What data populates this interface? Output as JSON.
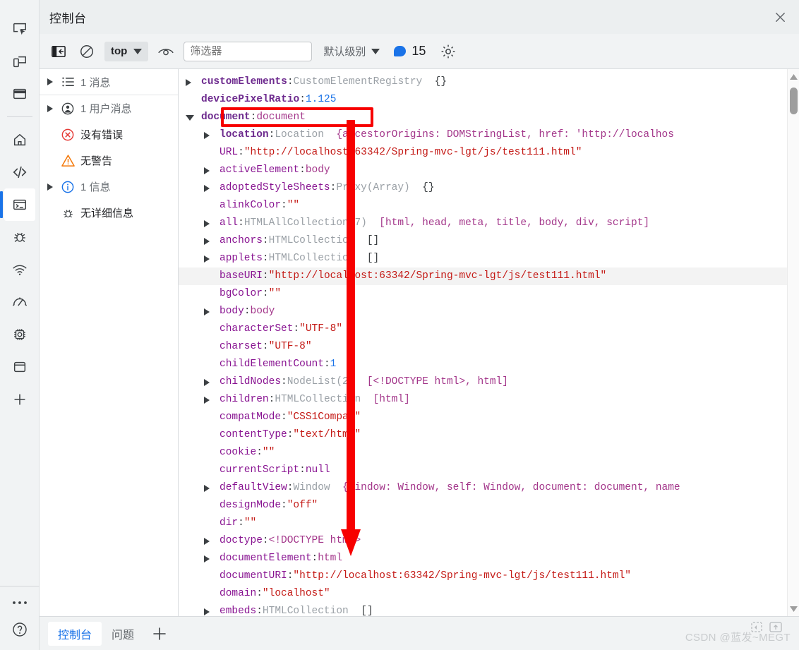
{
  "rail": {
    "icons": [
      {
        "name": "inspect-element-icon",
        "label": "检查元素"
      },
      {
        "name": "device-toolbar-icon",
        "label": "设备工具栏"
      },
      {
        "name": "elements-panel-icon",
        "label": "元素面板"
      },
      {
        "name": "home-icon",
        "label": "主页"
      },
      {
        "name": "sources-code-icon",
        "label": "源代码"
      },
      {
        "name": "console-terminal-icon",
        "label": "控制台"
      },
      {
        "name": "bug-icon",
        "label": "调试"
      },
      {
        "name": "network-wifi-icon",
        "label": "网络"
      },
      {
        "name": "performance-gauge-icon",
        "label": "性能"
      },
      {
        "name": "memory-chip-icon",
        "label": "内存"
      },
      {
        "name": "application-storage-icon",
        "label": "应用"
      },
      {
        "name": "add-panel-icon",
        "label": "添加"
      }
    ],
    "bottom": [
      {
        "name": "more-options-icon",
        "label": "更多选项"
      },
      {
        "name": "help-icon",
        "label": "帮助"
      }
    ]
  },
  "titlebar": {
    "title": "控制台",
    "close_label": "关闭"
  },
  "toolbar": {
    "clear_console_label": "清除控制台",
    "no_entry_label": "停止",
    "context": {
      "value": "top",
      "caret": "chevron-down-icon"
    },
    "eye_label": "实时表达式",
    "filter": {
      "value": "",
      "placeholder": "筛选器"
    },
    "level": {
      "value": "默认级别",
      "caret": "chevron-down-icon"
    },
    "message_count": "15",
    "settings_label": "设置"
  },
  "sidebar": {
    "items": [
      {
        "icon": "list-icon",
        "count": "1",
        "label": "消息",
        "expandable": true,
        "bordered": true
      },
      {
        "icon": "user-icon",
        "count": "1",
        "label": "用户消息",
        "expandable": true,
        "bordered": false
      },
      {
        "icon": "error-icon",
        "count": "",
        "label": "没有错误",
        "expandable": false,
        "bordered": false
      },
      {
        "icon": "warning-icon",
        "count": "",
        "label": "无警告",
        "expandable": false,
        "bordered": false
      },
      {
        "icon": "info-icon",
        "count": "1",
        "label": "信息",
        "expandable": true,
        "bordered": false
      },
      {
        "icon": "verbose-bug-icon",
        "count": "",
        "label": "无详细信息",
        "expandable": false,
        "bordered": false
      }
    ]
  },
  "console": {
    "lines": [
      {
        "arrow": "right",
        "indent": 1,
        "key": "customElements",
        "bold": true,
        "sep": ":",
        "type": "CustomElementRegistry",
        "preview": "{}",
        "previewKind": "punct",
        "highlight": false
      },
      {
        "arrow": "none",
        "indent": 1,
        "key": "devicePixelRatio",
        "bold": true,
        "sep": ":",
        "value": "1.125",
        "valueKind": "num",
        "highlight": false
      },
      {
        "arrow": "down",
        "indent": 1,
        "key": "document",
        "bold": true,
        "sep": ":",
        "value": "document",
        "valueKind": "prev",
        "highlight": false
      },
      {
        "arrow": "right",
        "indent": 2,
        "key": "location",
        "bold": true,
        "sep": ":",
        "type": "Location",
        "preview": "{ancestorOrigins: DOMStringList, href: 'http://localhos",
        "previewKind": "prev",
        "highlight": false
      },
      {
        "arrow": "none",
        "indent": 2,
        "key": "URL",
        "bold": false,
        "sep": ":",
        "value": "\"http://localhost:63342/Spring-mvc-lgt/js/test111.html\"",
        "valueKind": "str",
        "highlight": false
      },
      {
        "arrow": "right",
        "indent": 2,
        "key": "activeElement",
        "bold": false,
        "sep": ":",
        "value": "body",
        "valueKind": "prev",
        "highlight": false
      },
      {
        "arrow": "right",
        "indent": 2,
        "key": "adoptedStyleSheets",
        "bold": false,
        "sep": ":",
        "type": "Proxy(Array)",
        "preview": "{}",
        "previewKind": "punct",
        "highlight": false
      },
      {
        "arrow": "none",
        "indent": 2,
        "key": "alinkColor",
        "bold": false,
        "sep": ":",
        "value": "\"\"",
        "valueKind": "str",
        "highlight": false
      },
      {
        "arrow": "right",
        "indent": 2,
        "key": "all",
        "bold": false,
        "sep": ":",
        "type": "HTMLAllCollection(7)",
        "preview": "[html, head, meta, title, body, div, script]",
        "previewKind": "prev",
        "highlight": false
      },
      {
        "arrow": "right",
        "indent": 2,
        "key": "anchors",
        "bold": false,
        "sep": ":",
        "type": "HTMLCollection",
        "preview": "[]",
        "previewKind": "punct",
        "highlight": false
      },
      {
        "arrow": "right",
        "indent": 2,
        "key": "applets",
        "bold": false,
        "sep": ":",
        "type": "HTMLCollection",
        "preview": "[]",
        "previewKind": "punct",
        "highlight": false
      },
      {
        "arrow": "none",
        "indent": 2,
        "key": "baseURI",
        "bold": false,
        "sep": ":",
        "value": "\"http://localhost:63342/Spring-mvc-lgt/js/test111.html\"",
        "valueKind": "str",
        "highlight": true
      },
      {
        "arrow": "none",
        "indent": 2,
        "key": "bgColor",
        "bold": false,
        "sep": ":",
        "value": "\"\"",
        "valueKind": "str",
        "highlight": false
      },
      {
        "arrow": "right",
        "indent": 2,
        "key": "body",
        "bold": false,
        "sep": ":",
        "value": "body",
        "valueKind": "prev",
        "highlight": false
      },
      {
        "arrow": "none",
        "indent": 2,
        "key": "characterSet",
        "bold": false,
        "sep": ":",
        "value": "\"UTF-8\"",
        "valueKind": "str",
        "highlight": false
      },
      {
        "arrow": "none",
        "indent": 2,
        "key": "charset",
        "bold": false,
        "sep": ":",
        "value": "\"UTF-8\"",
        "valueKind": "str",
        "highlight": false
      },
      {
        "arrow": "none",
        "indent": 2,
        "key": "childElementCount",
        "bold": false,
        "sep": ":",
        "value": "1",
        "valueKind": "num",
        "highlight": false
      },
      {
        "arrow": "right",
        "indent": 2,
        "key": "childNodes",
        "bold": false,
        "sep": ":",
        "type": "NodeList(2)",
        "preview": "[<!DOCTYPE html>, html]",
        "previewKind": "prev",
        "highlight": false
      },
      {
        "arrow": "right",
        "indent": 2,
        "key": "children",
        "bold": false,
        "sep": ":",
        "type": "HTMLCollection",
        "preview": "[html]",
        "previewKind": "prev",
        "highlight": false
      },
      {
        "arrow": "none",
        "indent": 2,
        "key": "compatMode",
        "bold": false,
        "sep": ":",
        "value": "\"CSS1Compat\"",
        "valueKind": "str",
        "highlight": false
      },
      {
        "arrow": "none",
        "indent": 2,
        "key": "contentType",
        "bold": false,
        "sep": ":",
        "value": "\"text/html\"",
        "valueKind": "str",
        "highlight": false
      },
      {
        "arrow": "none",
        "indent": 2,
        "key": "cookie",
        "bold": false,
        "sep": ":",
        "value": "\"\"",
        "valueKind": "str",
        "highlight": false
      },
      {
        "arrow": "none",
        "indent": 2,
        "key": "currentScript",
        "bold": false,
        "sep": ":",
        "value": "null",
        "valueKind": "null",
        "highlight": false
      },
      {
        "arrow": "right",
        "indent": 2,
        "key": "defaultView",
        "bold": false,
        "sep": ":",
        "type": "Window",
        "preview": "{window: Window, self: Window, document: document, name",
        "previewKind": "prev",
        "highlight": false
      },
      {
        "arrow": "none",
        "indent": 2,
        "key": "designMode",
        "bold": false,
        "sep": ":",
        "value": "\"off\"",
        "valueKind": "str",
        "highlight": false
      },
      {
        "arrow": "none",
        "indent": 2,
        "key": "dir",
        "bold": false,
        "sep": ":",
        "value": "\"\"",
        "valueKind": "str",
        "highlight": false
      },
      {
        "arrow": "right",
        "indent": 2,
        "key": "doctype",
        "bold": false,
        "sep": ":",
        "value": "<!DOCTYPE html>",
        "valueKind": "prev",
        "highlight": false
      },
      {
        "arrow": "right",
        "indent": 2,
        "key": "documentElement",
        "bold": false,
        "sep": ":",
        "value": "html",
        "valueKind": "prev",
        "highlight": false
      },
      {
        "arrow": "none",
        "indent": 2,
        "key": "documentURI",
        "bold": false,
        "sep": ":",
        "value": "\"http://localhost:63342/Spring-mvc-lgt/js/test111.html\"",
        "valueKind": "str",
        "highlight": false
      },
      {
        "arrow": "none",
        "indent": 2,
        "key": "domain",
        "bold": false,
        "sep": ":",
        "value": "\"localhost\"",
        "valueKind": "str",
        "highlight": false
      },
      {
        "arrow": "right",
        "indent": 2,
        "key": "embeds",
        "bold": false,
        "sep": ":",
        "type": "HTMLCollection",
        "preview": "[]",
        "previewKind": "punct",
        "highlight": false
      }
    ]
  },
  "drawer": {
    "tabs": [
      {
        "label": "控制台",
        "selected": true
      },
      {
        "label": "问题",
        "selected": false
      }
    ],
    "add_label": "添加面板",
    "watermark": "CSDN @蓝发~MEGT"
  },
  "annotation": {
    "box_target": "document: document",
    "color": "#f70000"
  }
}
